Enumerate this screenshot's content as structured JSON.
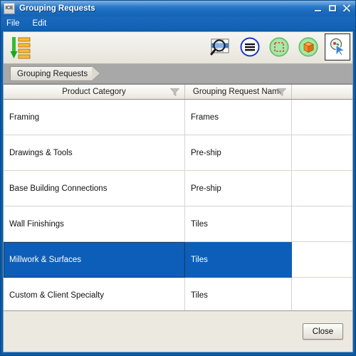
{
  "window": {
    "app_icon_label": "ICE",
    "title": "Grouping Requests",
    "minimize_label": "Minimize",
    "maximize_label": "Maximize",
    "close_label": "Close"
  },
  "menubar": {
    "items": [
      {
        "label": "File"
      },
      {
        "label": "Edit"
      }
    ]
  },
  "toolbar": {
    "left": [
      {
        "name": "sort-group-icon",
        "title": "Group"
      }
    ],
    "right": [
      {
        "name": "find-in-grid-icon",
        "title": "Find"
      },
      {
        "name": "list-menu-icon",
        "title": "List"
      },
      {
        "name": "select-region-icon",
        "title": "Select Region"
      },
      {
        "name": "object-cube-icon",
        "title": "Objects"
      },
      {
        "name": "pick-cursor-icon",
        "title": "Pick",
        "pressed": true
      }
    ]
  },
  "breadcrumb": {
    "items": [
      {
        "label": "Grouping Requests"
      }
    ]
  },
  "grid": {
    "columns": [
      {
        "label": "Product Category",
        "filter": true
      },
      {
        "label": "Grouping Request Name",
        "filter": true
      },
      {
        "label": "",
        "filter": false
      }
    ],
    "rows": [
      {
        "product_category": "Framing",
        "grouping_request_name": "Frames",
        "extra": "",
        "selected": false
      },
      {
        "product_category": "Drawings & Tools",
        "grouping_request_name": "Pre-ship",
        "extra": "",
        "selected": false
      },
      {
        "product_category": "Base Building Connections",
        "grouping_request_name": "Pre-ship",
        "extra": "",
        "selected": false
      },
      {
        "product_category": "Wall Finishings",
        "grouping_request_name": "Tiles",
        "extra": "",
        "selected": false
      },
      {
        "product_category": "Millwork & Surfaces",
        "grouping_request_name": "Tiles",
        "extra": "",
        "selected": true
      },
      {
        "product_category": "Custom & Client Specialty",
        "grouping_request_name": "Tiles",
        "extra": "",
        "selected": false
      }
    ]
  },
  "footer": {
    "close_label": "Close"
  },
  "colors": {
    "title_blue": "#1d6dc0",
    "selection_blue": "#0d5eb8",
    "crumb_strip": "#a8a8a8",
    "panel": "#ece9e1"
  }
}
